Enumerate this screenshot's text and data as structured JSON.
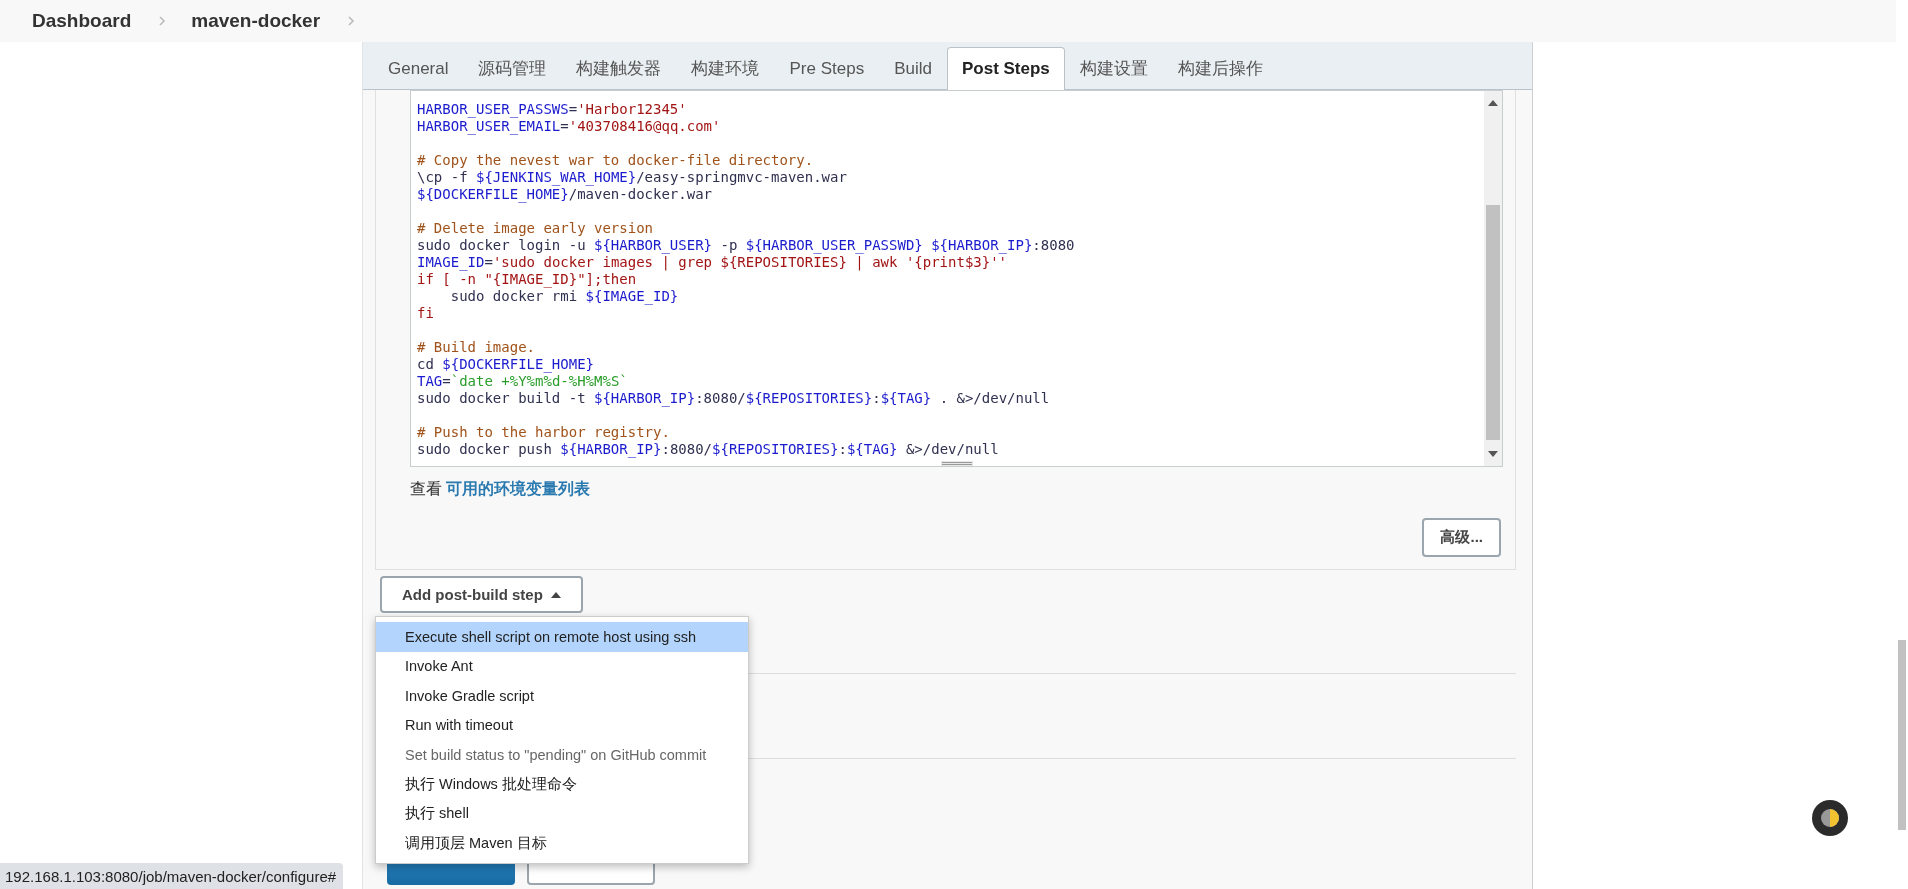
{
  "breadcrumbs": [
    {
      "label": "Dashboard"
    },
    {
      "label": "maven-docker"
    }
  ],
  "tabs": [
    {
      "label": "General",
      "selected": false
    },
    {
      "label": "源码管理",
      "selected": false
    },
    {
      "label": "构建触发器",
      "selected": false
    },
    {
      "label": "构建环境",
      "selected": false
    },
    {
      "label": "Pre Steps",
      "selected": false
    },
    {
      "label": "Build",
      "selected": false
    },
    {
      "label": "Post Steps",
      "selected": true
    },
    {
      "label": "构建设置",
      "selected": false
    },
    {
      "label": "构建后操作",
      "selected": false
    }
  ],
  "code_lines": [
    {
      "kind": "code",
      "segments": [
        {
          "kind": "var",
          "text": "HARBOR_USER_PASSWS"
        },
        {
          "kind": "plain",
          "text": "="
        },
        {
          "kind": "str",
          "text": "'Harbor12345'"
        }
      ]
    },
    {
      "kind": "code",
      "segments": [
        {
          "kind": "var",
          "text": "HARBOR_USER_EMAIL"
        },
        {
          "kind": "plain",
          "text": "="
        },
        {
          "kind": "str",
          "text": "'403708416@qq.com'"
        }
      ]
    },
    {
      "kind": "blank"
    },
    {
      "kind": "code",
      "segments": [
        {
          "kind": "comment",
          "text": "# Copy the nevest war to docker-file directory."
        }
      ]
    },
    {
      "kind": "code",
      "segments": [
        {
          "kind": "plain",
          "text": "\\cp -f "
        },
        {
          "kind": "var",
          "text": "${JENKINS_WAR_HOME}"
        },
        {
          "kind": "plain",
          "text": "/easy-springmvc-maven.war"
        }
      ]
    },
    {
      "kind": "code",
      "segments": [
        {
          "kind": "var",
          "text": "${DOCKERFILE_HOME}"
        },
        {
          "kind": "plain",
          "text": "/maven-docker.war"
        }
      ]
    },
    {
      "kind": "blank"
    },
    {
      "kind": "code",
      "segments": [
        {
          "kind": "comment",
          "text": "# Delete image early version"
        }
      ]
    },
    {
      "kind": "code",
      "segments": [
        {
          "kind": "plain",
          "text": "sudo docker login -u "
        },
        {
          "kind": "var",
          "text": "${HARBOR_USER}"
        },
        {
          "kind": "plain",
          "text": " -p "
        },
        {
          "kind": "var",
          "text": "${HARBOR_USER_PASSWD}"
        },
        {
          "kind": "var",
          "text": " ${HARBOR_IP}"
        },
        {
          "kind": "plain",
          "text": ":8080"
        }
      ]
    },
    {
      "kind": "code",
      "segments": [
        {
          "kind": "var",
          "text": "IMAGE_ID"
        },
        {
          "kind": "plain",
          "text": "="
        },
        {
          "kind": "str",
          "text": "'sudo docker images | grep ${REPOSITORIES} | awk '{print$3}''"
        }
      ]
    },
    {
      "kind": "code",
      "segments": [
        {
          "kind": "str",
          "text": "if [ -n \"{IMAGE_ID}\"];then"
        }
      ]
    },
    {
      "kind": "code",
      "segments": [
        {
          "kind": "plain",
          "text": "    sudo docker rmi "
        },
        {
          "kind": "var",
          "text": "${IMAGE_ID}"
        }
      ]
    },
    {
      "kind": "code",
      "segments": [
        {
          "kind": "str",
          "text": "fi"
        }
      ]
    },
    {
      "kind": "blank"
    },
    {
      "kind": "code",
      "segments": [
        {
          "kind": "comment",
          "text": "# Build image."
        }
      ]
    },
    {
      "kind": "code",
      "segments": [
        {
          "kind": "plain",
          "text": "cd "
        },
        {
          "kind": "var",
          "text": "${DOCKERFILE_HOME}"
        }
      ]
    },
    {
      "kind": "code",
      "segments": [
        {
          "kind": "var",
          "text": "TAG"
        },
        {
          "kind": "plain",
          "text": "="
        },
        {
          "kind": "cmd",
          "text": "`date +%Y%m%d-%H%M%S`"
        }
      ]
    },
    {
      "kind": "code",
      "segments": [
        {
          "kind": "plain",
          "text": "sudo docker build -t "
        },
        {
          "kind": "var",
          "text": "${HARBOR_IP}"
        },
        {
          "kind": "plain",
          "text": ":8080/"
        },
        {
          "kind": "var",
          "text": "${REPOSITORIES}"
        },
        {
          "kind": "plain",
          "text": ":"
        },
        {
          "kind": "var",
          "text": "${TAG}"
        },
        {
          "kind": "plain",
          "text": " . &>/dev/null"
        }
      ]
    },
    {
      "kind": "blank"
    },
    {
      "kind": "code",
      "segments": [
        {
          "kind": "comment",
          "text": "# Push to the harbor registry."
        }
      ]
    },
    {
      "kind": "code",
      "segments": [
        {
          "kind": "plain",
          "text": "sudo docker push "
        },
        {
          "kind": "var",
          "text": "${HARBOR_IP}"
        },
        {
          "kind": "plain",
          "text": ":8080/"
        },
        {
          "kind": "var",
          "text": "${REPOSITORIES}"
        },
        {
          "kind": "plain",
          "text": ":"
        },
        {
          "kind": "var",
          "text": "${TAG}"
        },
        {
          "kind": "plain",
          "text": " &>/dev/null"
        }
      ]
    }
  ],
  "env_hint": {
    "prefix": "查看",
    "link": "可用的环境变量列表"
  },
  "advanced_button": "高级...",
  "add_step_button": "Add post-build step",
  "menu_items": [
    {
      "label": "Execute shell script on remote host using ssh",
      "selected": true,
      "disabled": false
    },
    {
      "label": "Invoke Ant",
      "selected": false,
      "disabled": false
    },
    {
      "label": "Invoke Gradle script",
      "selected": false,
      "disabled": false
    },
    {
      "label": "Run with timeout",
      "selected": false,
      "disabled": false
    },
    {
      "label": "Set build status to \"pending\" on GitHub commit",
      "selected": false,
      "disabled": true
    },
    {
      "label": "执行 Windows 批处理命令",
      "selected": false,
      "disabled": false
    },
    {
      "label": "执行 shell",
      "selected": false,
      "disabled": false
    },
    {
      "label": "调用顶层 Maven 目标",
      "selected": false,
      "disabled": false
    }
  ],
  "status_url": "192.168.1.103:8080/job/maven-docker/configure#"
}
